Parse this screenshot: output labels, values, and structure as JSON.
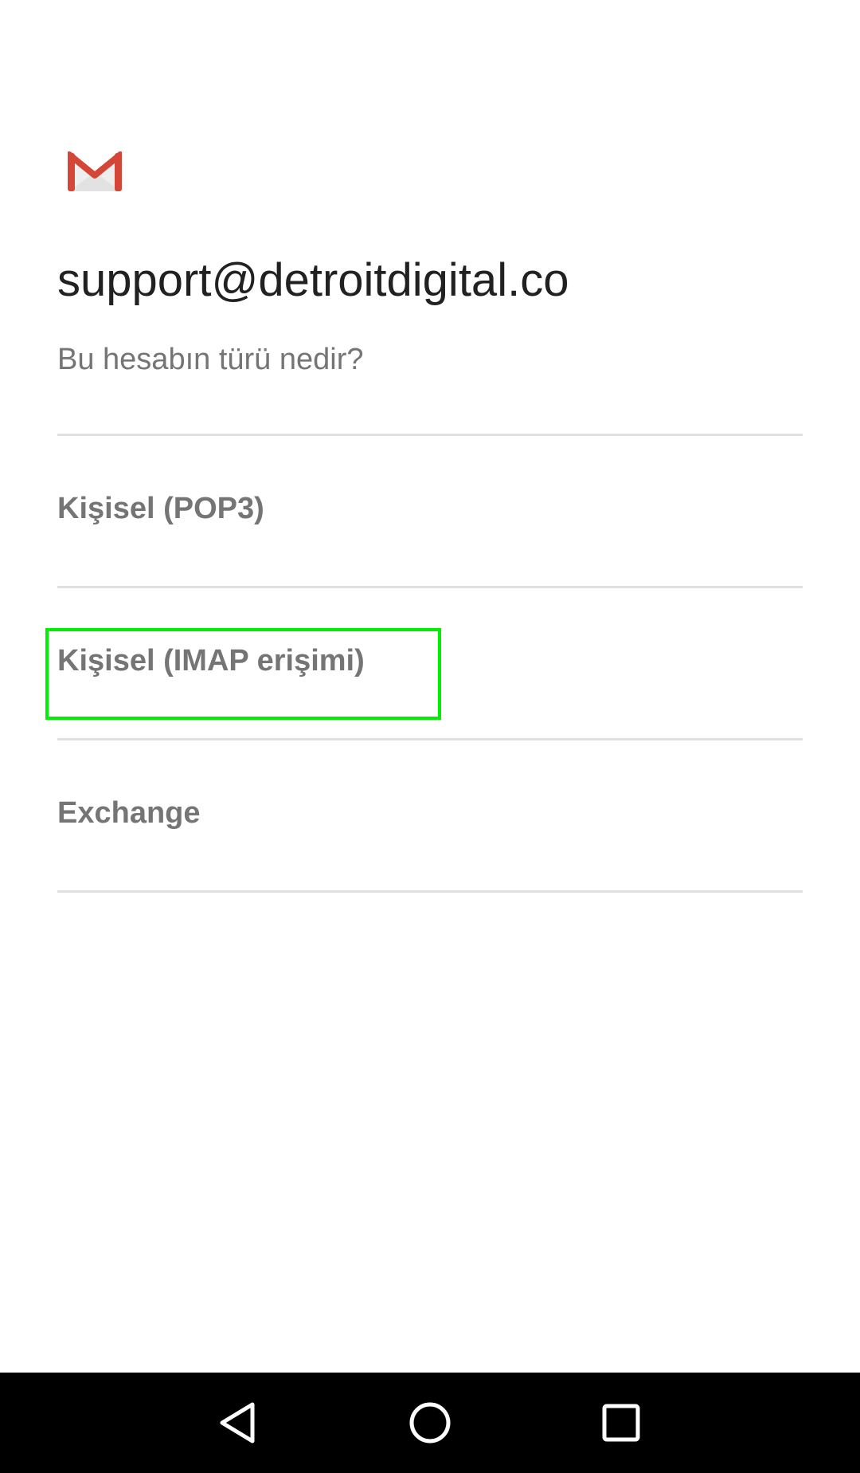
{
  "app": {
    "logo_icon": "gmail-logo",
    "accent_color": "#D44638"
  },
  "account": {
    "email": "support@detroitdigital.co",
    "question": "Bu hesabın türü nedir?"
  },
  "options": [
    {
      "label": "Kişisel (POP3)"
    },
    {
      "label": "Kişisel (IMAP erişimi)",
      "highlighted": true
    },
    {
      "label": "Exchange"
    }
  ],
  "highlight_color": "#00ee00",
  "navbar": {
    "back_icon": "back-triangle-icon",
    "home_icon": "home-circle-icon",
    "recents_icon": "recents-square-icon"
  }
}
